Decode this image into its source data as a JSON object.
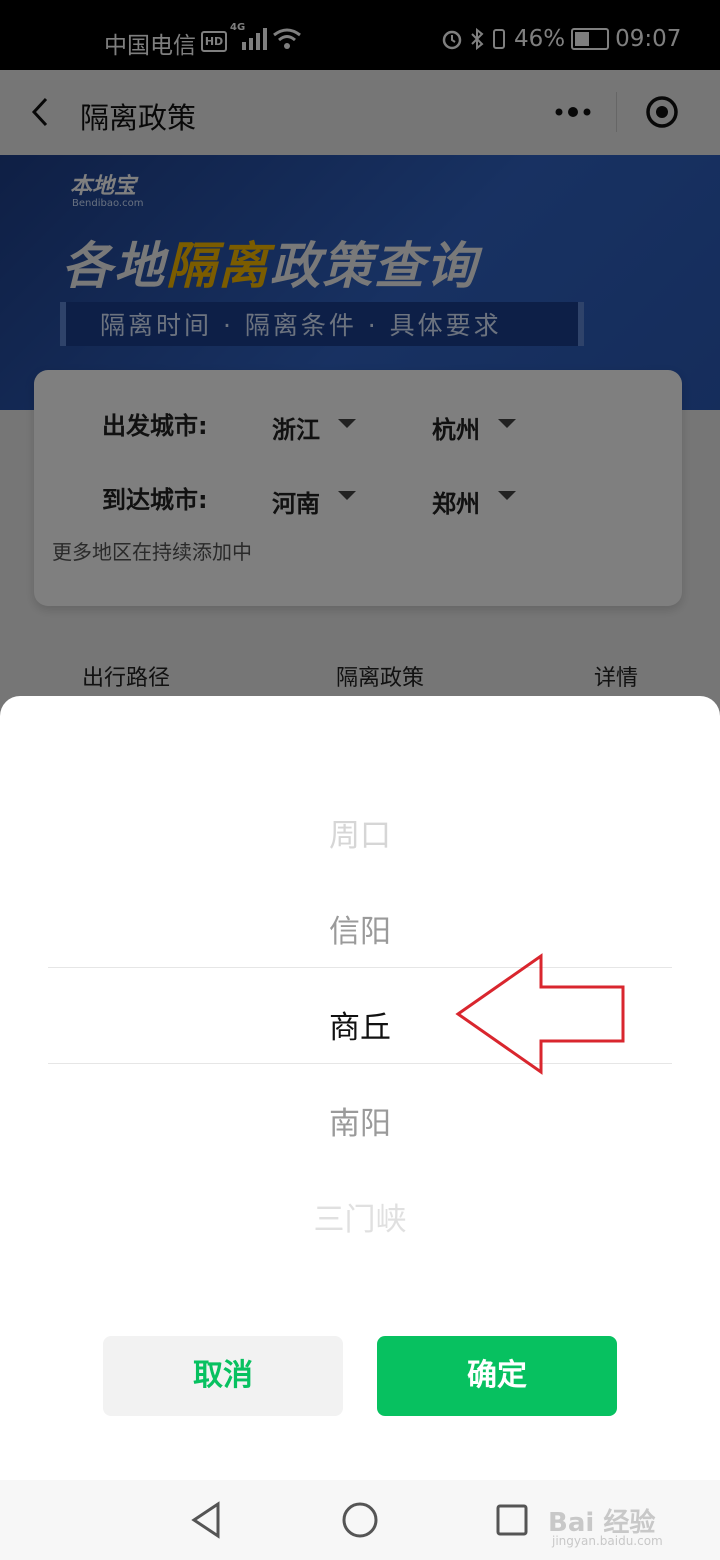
{
  "status_bar": {
    "carrier": "中国电信",
    "hd": "HD",
    "network": "4G",
    "battery": "46%",
    "time": "09:07"
  },
  "header": {
    "title": "隔离政策"
  },
  "banner": {
    "logo": "本地宝",
    "logo_sub": "Bendibao.com",
    "title_part1": "各地",
    "title_part2": "隔离",
    "title_part3": "政策查询",
    "subtitle": "隔离时间 · 隔离条件 · 具体要求"
  },
  "form": {
    "depart_label": "出发城市:",
    "depart_province": "浙江",
    "depart_city": "杭州",
    "arrive_label": "到达城市:",
    "arrive_province": "河南",
    "arrive_city": "郑州",
    "hint": "更多地区在持续添加中"
  },
  "table_header": [
    "出行路径",
    "隔离政策",
    "详情"
  ],
  "picker": {
    "options": [
      "周口",
      "信阳",
      "商丘",
      "南阳",
      "三门峡"
    ],
    "selected": "商丘",
    "cancel_label": "取消",
    "confirm_label": "确定",
    "accent_color": "#07c160",
    "arrow_color": "#d9262e"
  },
  "watermark": {
    "text": "Bai 经验",
    "sub": "jingyan.baidu.com"
  }
}
